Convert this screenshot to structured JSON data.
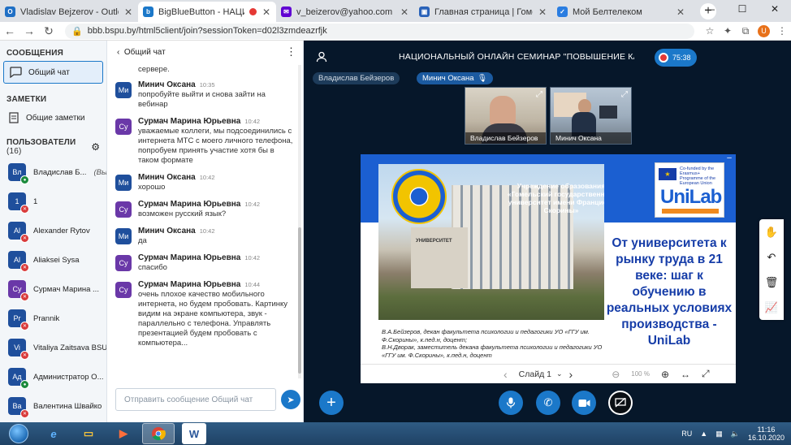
{
  "browser": {
    "tabs": [
      {
        "title": "Vladislav Bejzerov - Outlook We",
        "color": "#1f6fc5",
        "glyph": "O",
        "active": false,
        "recording": false
      },
      {
        "title": "BigBlueButton - НАЦИОНА",
        "color": "#1b78c9",
        "glyph": "b",
        "active": true,
        "recording": true
      },
      {
        "title": "v_beizerov@yahoo.com — Yaho",
        "color": "#6001d2",
        "glyph": "✉",
        "active": false,
        "recording": false
      },
      {
        "title": "Главная страница | Гомельский",
        "color": "#2962b9",
        "glyph": "▣",
        "active": false,
        "recording": false
      },
      {
        "title": "Мой Белтелеком",
        "color": "#2a7de1",
        "glyph": "✓",
        "active": false,
        "recording": false
      }
    ],
    "new_tab": "+",
    "window_controls": [
      "—",
      "☐",
      "✕"
    ],
    "address": "bbb.bspu.by/html5client/join?sessionToken=d02l3zmdeazrfjk",
    "profile_letter": "U"
  },
  "left": {
    "messages_title": "СООБЩЕНИЯ",
    "public_chat": "Общий чат",
    "notes_title": "ЗАМЕТКИ",
    "shared_notes": "Общие заметки",
    "users_title": "ПОЛЬЗОВАТЕЛИ",
    "users_count": "(16)",
    "users": [
      {
        "initials": "Вл",
        "name": "Владислав Б...",
        "suffix": "(Вы)",
        "mic": "on",
        "color": "#1f4f9c"
      },
      {
        "initials": "1",
        "name": "1",
        "suffix": "",
        "mic": "muted",
        "color": "#1f4f9c"
      },
      {
        "initials": "Al",
        "name": "Alexander Rytov",
        "suffix": "",
        "mic": "muted",
        "color": "#1f4f9c"
      },
      {
        "initials": "Al",
        "name": "Aliaksei Sysa",
        "suffix": "",
        "mic": "muted",
        "color": "#1f4f9c"
      },
      {
        "initials": "Су",
        "name": "Сурмач Марина ...",
        "suffix": "",
        "mic": "muted",
        "color": "#6a38a8"
      },
      {
        "initials": "Pr",
        "name": "Prannik",
        "suffix": "",
        "mic": "muted",
        "color": "#1f4f9c"
      },
      {
        "initials": "Vi",
        "name": "Vitaliya Zaitsava BSU",
        "suffix": "",
        "mic": "muted",
        "color": "#1f4f9c"
      },
      {
        "initials": "Ад",
        "name": "Администратор О...",
        "suffix": "",
        "mic": "on",
        "color": "#1f4f9c"
      },
      {
        "initials": "Ва",
        "name": "Валентина Швайко",
        "suffix": "",
        "mic": "muted",
        "color": "#1f4f9c"
      }
    ]
  },
  "chat": {
    "header": "Общий чат",
    "top_fragment": "сервере.",
    "messages": [
      {
        "initials": "Ми",
        "name": "Минич Оксана",
        "time": "10:35",
        "text": "попробуйте выйти и снова зайти на вебинар",
        "color": "#1f4f9c"
      },
      {
        "initials": "Су",
        "name": "Сурмач Марина Юрьевна",
        "time": "10:42",
        "text": "уважаемые коллеги, мы подсоединились с интернета МТС с моего личного телефона, попробуем принять участие хотя бы в таком формате",
        "color": "#6a38a8"
      },
      {
        "initials": "Ми",
        "name": "Минич Оксана",
        "time": "10:42",
        "text": "хорошо",
        "color": "#1f4f9c"
      },
      {
        "initials": "Су",
        "name": "Сурмач Марина Юрьевна",
        "time": "10:42",
        "text": "возможен русский язык?",
        "color": "#6a38a8"
      },
      {
        "initials": "Ми",
        "name": "Минич Оксана",
        "time": "10:42",
        "text": "да",
        "color": "#1f4f9c"
      },
      {
        "initials": "Су",
        "name": "Сурмач Марина Юрьевна",
        "time": "10:42",
        "text": "спасибо",
        "color": "#6a38a8"
      },
      {
        "initials": "Су",
        "name": "Сурмач Марина Юрьевна",
        "time": "10:44",
        "text": "очень плохое качество мобильного интернета, но будем пробовать. Картинку видим на экране компьютера, звук - параллельно с телефона. Управлять презентацией будем пробовать с компьютера...",
        "color": "#6a38a8"
      }
    ],
    "input_placeholder": "Отправить сообщение Общий чат"
  },
  "meeting": {
    "title": "НАЦИОНАЛЬНЫЙ ОНЛАЙН СЕМИНАР \"ПОВЫШЕНИЕ КАЧЕ...",
    "timer": "75:38",
    "talkers": [
      "Владислав Бейзеров",
      "Минич Оксана"
    ],
    "videos": [
      {
        "name": "Владислав Бейзеров"
      },
      {
        "name": "Минич Оксана"
      }
    ]
  },
  "slide": {
    "institution": "Учреждение образования «Гомельский государственный университет имени Франциска Скорины»",
    "eu_text": "Co-funded by the Erasmus+ Programme of the European Union",
    "logo_uni": "Uni",
    "logo_lab": "Lab",
    "headline": "От университета к рынку труда в 21 веке: шаг к обучению в реальных условиях производства - UniLab",
    "author1": "В.А.Бейзеров, декан факультета психологии и педагогики УО «ГГУ им. Ф.Скорины», к.пед.н, доцент;",
    "author2": "В.Н.Дворак, заместитель декана факультета психологии и педагогики УО «ГГУ им. Ф.Скорины», к.пед.н, доцент",
    "building_sign": "УНИВЕРСИТЕТ",
    "nav_prev": "‹",
    "nav_label": "Слайд 1",
    "nav_next": "›",
    "zoom_out": "⊖",
    "zoom": "100 %",
    "zoom_in": "⊕",
    "fit": "↔",
    "fullscreen": "⤢"
  },
  "taskbar": {
    "lang": "RU",
    "time": "11:16",
    "date": "16.10.2020"
  }
}
